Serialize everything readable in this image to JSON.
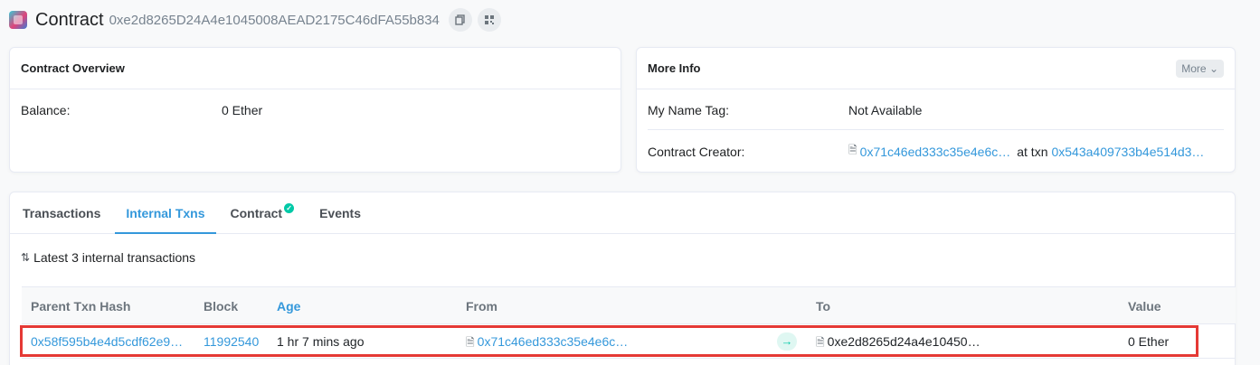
{
  "header": {
    "title": "Contract",
    "address": "0xe2d8265D24A4e1045008AEAD2175C46dFA55b834"
  },
  "overview": {
    "title": "Contract Overview",
    "balance_label": "Balance:",
    "balance_value": "0 Ether"
  },
  "more_info": {
    "title": "More Info",
    "more_button": "More",
    "name_tag_label": "My Name Tag:",
    "name_tag_value": "Not Available",
    "creator_label": "Contract Creator:",
    "creator_address": "0x71c46ed333c35e4e6c…",
    "at_txn_label": "at txn",
    "creator_txn": "0x543a409733b4e514d3…"
  },
  "tabs": {
    "transactions": "Transactions",
    "internal_txns": "Internal Txns",
    "contract": "Contract",
    "events": "Events"
  },
  "summary": "Latest 3 internal transactions",
  "table": {
    "headers": {
      "parent_txn_hash": "Parent Txn Hash",
      "block": "Block",
      "age": "Age",
      "from": "From",
      "to": "To",
      "value": "Value"
    },
    "rows": [
      {
        "parent_txn_hash": "0x58f595b4e4d5cdf62e9…",
        "block": "11992540",
        "age": "1 hr 7 mins ago",
        "from": "0x71c46ed333c35e4e6c…",
        "to": "0xe2d8265d24a4e10450…",
        "value": "0 Ether"
      }
    ]
  },
  "colors": {
    "link": "#3498db",
    "highlight": "#e53935",
    "success": "#00c9a7"
  }
}
